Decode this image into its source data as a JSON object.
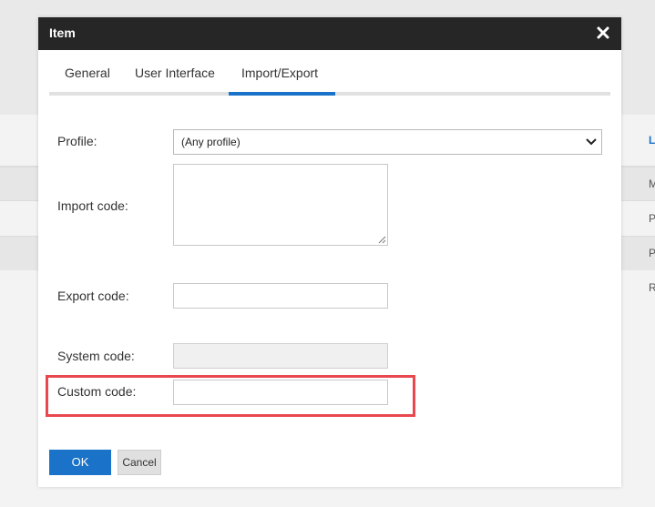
{
  "background": {
    "link_text": "L",
    "row_letters": [
      "M",
      "P",
      "P",
      "R"
    ]
  },
  "dialog": {
    "title": "Item",
    "close_icon": "close-icon",
    "tabs": [
      {
        "label": "General"
      },
      {
        "label": "User Interface"
      },
      {
        "label": "Import/Export"
      }
    ],
    "active_tab": "Import/Export",
    "fields": {
      "profile": {
        "label": "Profile:",
        "value": "(Any profile)"
      },
      "import_code": {
        "label": "Import code:",
        "value": ""
      },
      "export_code": {
        "label": "Export code:",
        "value": ""
      },
      "system_code": {
        "label": "System code:",
        "value": ""
      },
      "custom_code": {
        "label": "Custom code:",
        "value": ""
      }
    },
    "buttons": {
      "ok": "OK",
      "cancel": "Cancel"
    }
  },
  "colors": {
    "accent": "#1a73c9",
    "titlebar": "#262626",
    "highlight": "#e8484e"
  }
}
